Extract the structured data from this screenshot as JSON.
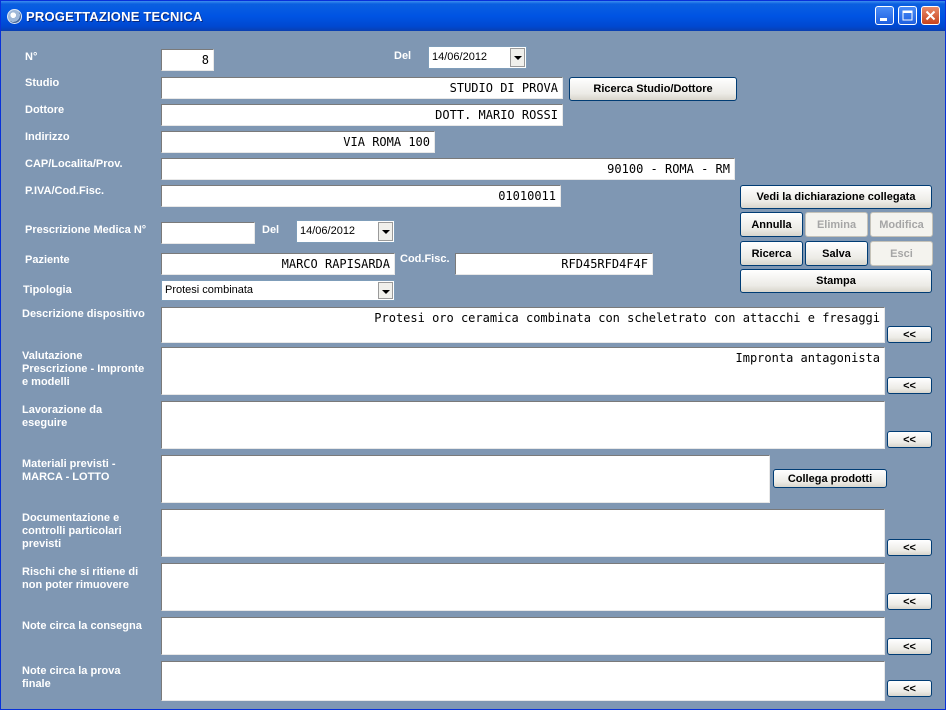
{
  "window": {
    "title": "PROGETTAZIONE TECNICA"
  },
  "labels": {
    "numero": "N°",
    "del": "Del",
    "studio": "Studio",
    "dottore": "Dottore",
    "indirizzo": "Indirizzo",
    "cap": "CAP/Localita/Prov.",
    "piva": "P.IVA/Cod.Fisc.",
    "prescrizione": "Prescrizione Medica N°",
    "del2": "Del",
    "paziente": "Paziente",
    "codfisc": "Cod.Fisc.",
    "tipologia": "Tipologia",
    "descrizione": "Descrizione dispositivo",
    "valutazione": "Valutazione Prescrizione - Impronte e modelli",
    "lavorazione": "Lavorazione da eseguire",
    "materiali": "Materiali previsti - MARCA - LOTTO",
    "documentazione": "Documentazione e controlli particolari previsti",
    "rischi": "Rischi che si ritiene di non poter rimuovere",
    "note_consegna": "Note circa la consegna",
    "note_prova": "Note circa la prova finale"
  },
  "values": {
    "numero": "8",
    "data": "14/06/2012",
    "studio": "STUDIO DI PROVA",
    "dottore": "DOTT. MARIO ROSSI",
    "indirizzo": "VIA ROMA 100",
    "cap": "90100 - ROMA - RM",
    "piva": "01010011",
    "prescrizione": "",
    "data_prescrizione": "14/06/2012",
    "paziente": "MARCO RAPISARDA",
    "codfisc": "RFD45RFD4F4F",
    "tipologia": "Protesi combinata",
    "descrizione": "Protesi oro ceramica combinata con scheletrato con attacchi e fresaggi",
    "valutazione": "Impronta antagonista",
    "lavorazione": "",
    "materiali": "",
    "documentazione": "",
    "rischi": "",
    "note_consegna": "",
    "note_prova": ""
  },
  "buttons": {
    "ricerca_studio": "Ricerca Studio/Dottore",
    "vedi_dichiarazione": "Vedi la dichiarazione collegata",
    "annulla": "Annulla",
    "elimina": "Elimina",
    "modifica": "Modifica",
    "ricerca": "Ricerca",
    "salva": "Salva",
    "esci": "Esci",
    "stampa": "Stampa",
    "collega_prodotti": "Collega prodotti",
    "back": "<<"
  }
}
